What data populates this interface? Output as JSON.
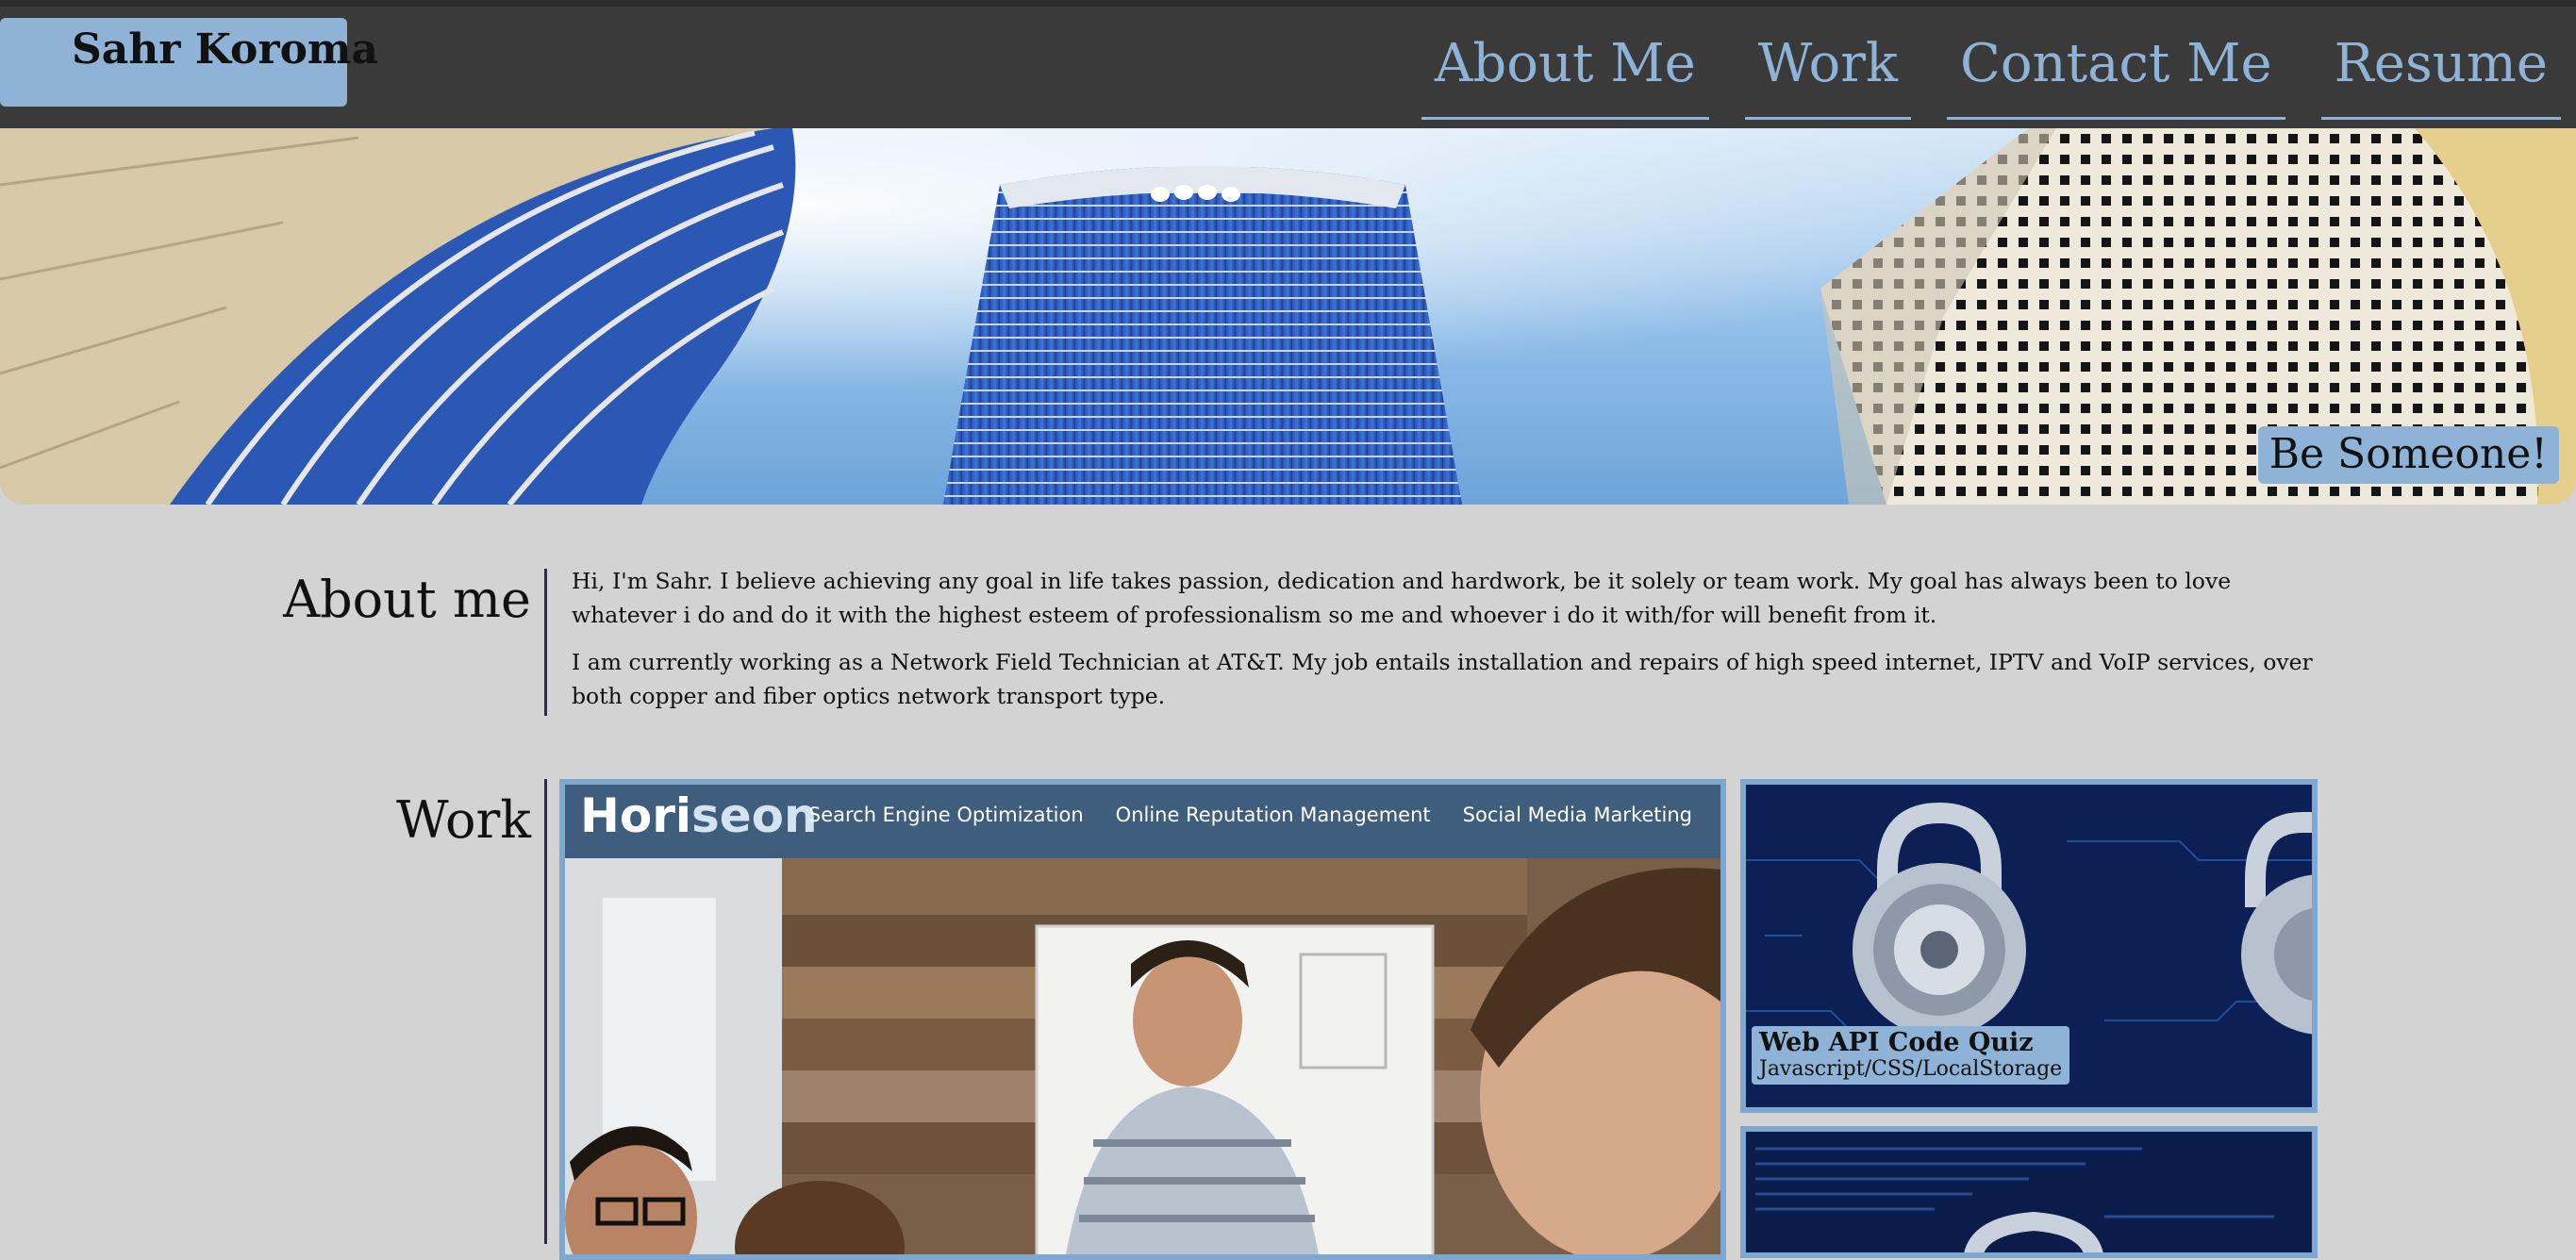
{
  "header": {
    "brand": "Sahr Koroma",
    "nav": [
      "About Me",
      "Work",
      "Contact Me",
      "Resume"
    ]
  },
  "hero": {
    "badge": "Be Someone!"
  },
  "about": {
    "title": "About me",
    "paragraphs": [
      "Hi, I'm Sahr. I believe achieving any goal in life takes passion, dedication and hardwork, be it solely or team work. My goal has always been to love whatever i do and do it with the highest esteem of professionalism so me and whoever i do it with/for will benefit from it.",
      "I am currently working as a Network Field Technician at AT&T. My job entails installation and repairs of high speed internet, IPTV and VoIP services, over both copper and fiber optics network transport type."
    ]
  },
  "work": {
    "title": "Work",
    "featured": {
      "logo_main": "Hori",
      "logo_accent": "seon",
      "links": [
        "Search Engine Optimization",
        "Online Reputation Management",
        "Social Media Marketing"
      ]
    },
    "cards": [
      {
        "title": "Web API Code Quiz",
        "subtitle": "Javascript/CSS/LocalStorage"
      }
    ]
  },
  "colors": {
    "header_bg": "#3a3a3a",
    "accent": "#8fb3d6",
    "page_bg": "#d3d3d3",
    "rule": "#2a2a55"
  }
}
